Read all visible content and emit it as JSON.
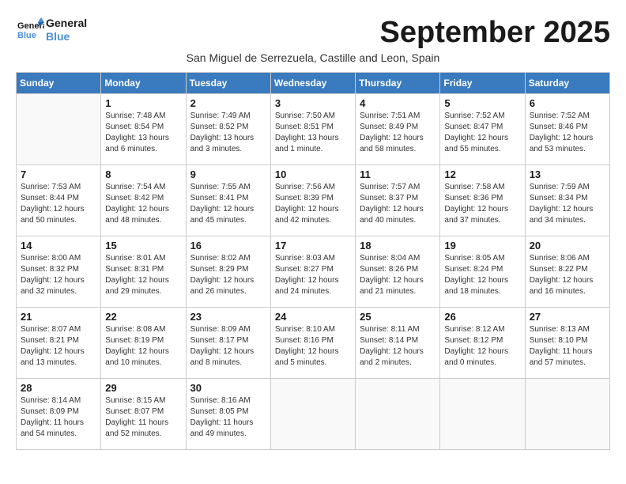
{
  "logo": {
    "line1": "General",
    "line2": "Blue"
  },
  "title": "September 2025",
  "location": "San Miguel de Serrezuela, Castille and Leon, Spain",
  "weekdays": [
    "Sunday",
    "Monday",
    "Tuesday",
    "Wednesday",
    "Thursday",
    "Friday",
    "Saturday"
  ],
  "weeks": [
    [
      {
        "day": "",
        "content": ""
      },
      {
        "day": "1",
        "content": "Sunrise: 7:48 AM\nSunset: 8:54 PM\nDaylight: 13 hours\nand 6 minutes."
      },
      {
        "day": "2",
        "content": "Sunrise: 7:49 AM\nSunset: 8:52 PM\nDaylight: 13 hours\nand 3 minutes."
      },
      {
        "day": "3",
        "content": "Sunrise: 7:50 AM\nSunset: 8:51 PM\nDaylight: 13 hours\nand 1 minute."
      },
      {
        "day": "4",
        "content": "Sunrise: 7:51 AM\nSunset: 8:49 PM\nDaylight: 12 hours\nand 58 minutes."
      },
      {
        "day": "5",
        "content": "Sunrise: 7:52 AM\nSunset: 8:47 PM\nDaylight: 12 hours\nand 55 minutes."
      },
      {
        "day": "6",
        "content": "Sunrise: 7:52 AM\nSunset: 8:46 PM\nDaylight: 12 hours\nand 53 minutes."
      }
    ],
    [
      {
        "day": "7",
        "content": "Sunrise: 7:53 AM\nSunset: 8:44 PM\nDaylight: 12 hours\nand 50 minutes."
      },
      {
        "day": "8",
        "content": "Sunrise: 7:54 AM\nSunset: 8:42 PM\nDaylight: 12 hours\nand 48 minutes."
      },
      {
        "day": "9",
        "content": "Sunrise: 7:55 AM\nSunset: 8:41 PM\nDaylight: 12 hours\nand 45 minutes."
      },
      {
        "day": "10",
        "content": "Sunrise: 7:56 AM\nSunset: 8:39 PM\nDaylight: 12 hours\nand 42 minutes."
      },
      {
        "day": "11",
        "content": "Sunrise: 7:57 AM\nSunset: 8:37 PM\nDaylight: 12 hours\nand 40 minutes."
      },
      {
        "day": "12",
        "content": "Sunrise: 7:58 AM\nSunset: 8:36 PM\nDaylight: 12 hours\nand 37 minutes."
      },
      {
        "day": "13",
        "content": "Sunrise: 7:59 AM\nSunset: 8:34 PM\nDaylight: 12 hours\nand 34 minutes."
      }
    ],
    [
      {
        "day": "14",
        "content": "Sunrise: 8:00 AM\nSunset: 8:32 PM\nDaylight: 12 hours\nand 32 minutes."
      },
      {
        "day": "15",
        "content": "Sunrise: 8:01 AM\nSunset: 8:31 PM\nDaylight: 12 hours\nand 29 minutes."
      },
      {
        "day": "16",
        "content": "Sunrise: 8:02 AM\nSunset: 8:29 PM\nDaylight: 12 hours\nand 26 minutes."
      },
      {
        "day": "17",
        "content": "Sunrise: 8:03 AM\nSunset: 8:27 PM\nDaylight: 12 hours\nand 24 minutes."
      },
      {
        "day": "18",
        "content": "Sunrise: 8:04 AM\nSunset: 8:26 PM\nDaylight: 12 hours\nand 21 minutes."
      },
      {
        "day": "19",
        "content": "Sunrise: 8:05 AM\nSunset: 8:24 PM\nDaylight: 12 hours\nand 18 minutes."
      },
      {
        "day": "20",
        "content": "Sunrise: 8:06 AM\nSunset: 8:22 PM\nDaylight: 12 hours\nand 16 minutes."
      }
    ],
    [
      {
        "day": "21",
        "content": "Sunrise: 8:07 AM\nSunset: 8:21 PM\nDaylight: 12 hours\nand 13 minutes."
      },
      {
        "day": "22",
        "content": "Sunrise: 8:08 AM\nSunset: 8:19 PM\nDaylight: 12 hours\nand 10 minutes."
      },
      {
        "day": "23",
        "content": "Sunrise: 8:09 AM\nSunset: 8:17 PM\nDaylight: 12 hours\nand 8 minutes."
      },
      {
        "day": "24",
        "content": "Sunrise: 8:10 AM\nSunset: 8:16 PM\nDaylight: 12 hours\nand 5 minutes."
      },
      {
        "day": "25",
        "content": "Sunrise: 8:11 AM\nSunset: 8:14 PM\nDaylight: 12 hours\nand 2 minutes."
      },
      {
        "day": "26",
        "content": "Sunrise: 8:12 AM\nSunset: 8:12 PM\nDaylight: 12 hours\nand 0 minutes."
      },
      {
        "day": "27",
        "content": "Sunrise: 8:13 AM\nSunset: 8:10 PM\nDaylight: 11 hours\nand 57 minutes."
      }
    ],
    [
      {
        "day": "28",
        "content": "Sunrise: 8:14 AM\nSunset: 8:09 PM\nDaylight: 11 hours\nand 54 minutes."
      },
      {
        "day": "29",
        "content": "Sunrise: 8:15 AM\nSunset: 8:07 PM\nDaylight: 11 hours\nand 52 minutes."
      },
      {
        "day": "30",
        "content": "Sunrise: 8:16 AM\nSunset: 8:05 PM\nDaylight: 11 hours\nand 49 minutes."
      },
      {
        "day": "",
        "content": ""
      },
      {
        "day": "",
        "content": ""
      },
      {
        "day": "",
        "content": ""
      },
      {
        "day": "",
        "content": ""
      }
    ]
  ]
}
